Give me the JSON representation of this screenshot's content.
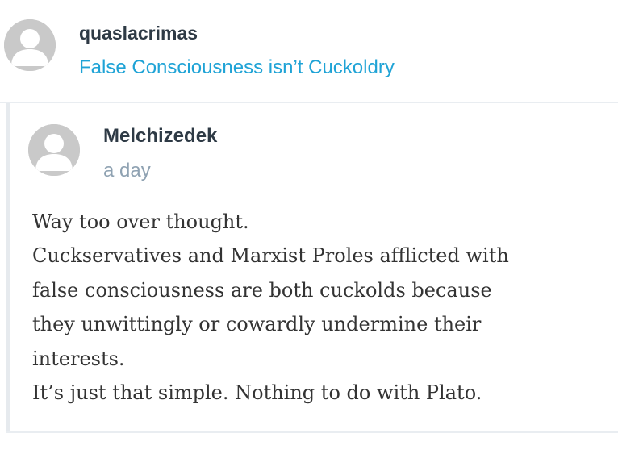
{
  "top_comment": {
    "author": "quaslacrimas",
    "post_title": "False Consciousness isn’t Cuckoldry",
    "avatar_icon": "default-user-avatar-icon"
  },
  "reply": {
    "author": "Melchizedek",
    "time": "a day",
    "avatar_icon": "default-user-avatar-icon",
    "body_lines": [
      "Way too over thought.",
      "Cuckservatives and Marxist Proles afflicted with",
      "false consciousness are both cuckolds because",
      "they unwittingly or cowardly undermine their",
      "interests.",
      "It’s just that simple. Nothing to do with Plato."
    ]
  },
  "colors": {
    "author": "#2e3a45",
    "link": "#1fa3d6",
    "timestamp": "#8fa2b2",
    "body_text": "#333333",
    "avatar_bg": "#c9c9c9",
    "divider": "#e9edf1"
  }
}
